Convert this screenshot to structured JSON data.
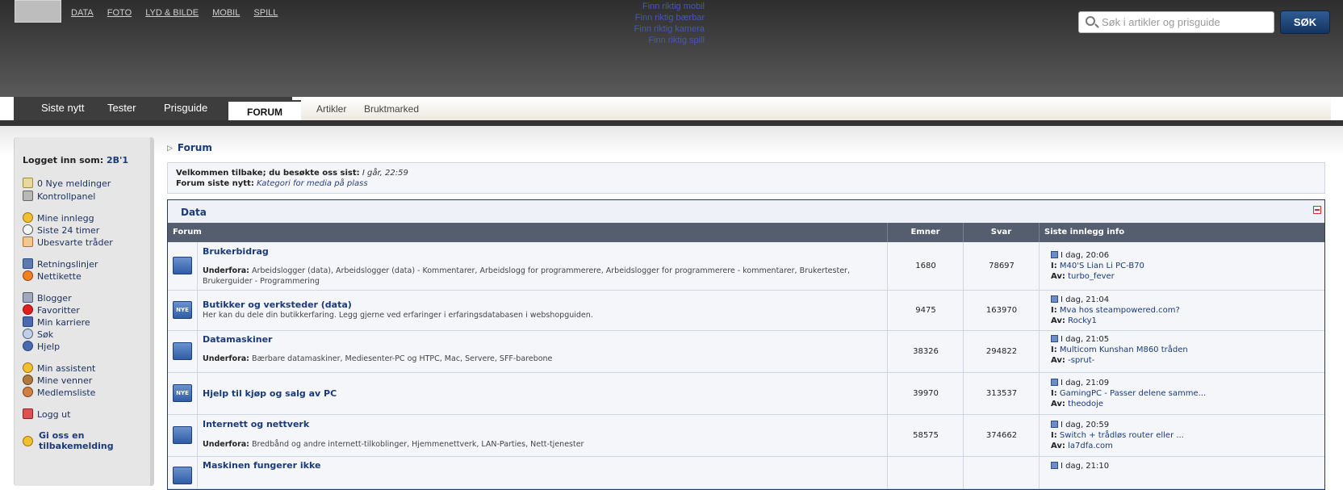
{
  "header": {
    "top_nav": [
      "DATA",
      "FOTO",
      "LYD & BILDE",
      "MOBIL",
      "SPILL"
    ],
    "promo_links": [
      "Finn riktig mobil",
      "Finn riktig bærbar",
      "Finn riktig kamera",
      "Finn riktig spill"
    ],
    "search_placeholder": "Søk i artikler og prisguide",
    "search_button": "SØK"
  },
  "tabs": {
    "main": [
      "Siste nytt",
      "Tester",
      "Prisguide",
      "FORUM"
    ],
    "sub": [
      "Artikler",
      "Bruktmarked"
    ]
  },
  "sidebar": {
    "login_label": "Logget inn som:",
    "username": "2B'1",
    "items": [
      {
        "label": "0 Nye meldinger",
        "icon": "mail-icon"
      },
      {
        "label": "Kontrollpanel",
        "icon": "tools-icon"
      },
      {
        "label": "Mine innlegg",
        "icon": "smiley-icon"
      },
      {
        "label": "Siste 24 timer",
        "icon": "clock-icon"
      },
      {
        "label": "Ubesvarte tråder",
        "icon": "envelope-icon"
      },
      {
        "label": "Retningslinjer",
        "icon": "rules-icon"
      },
      {
        "label": "Nettikette",
        "icon": "warning-icon"
      },
      {
        "label": "Blogger",
        "icon": "blog-icon"
      },
      {
        "label": "Favoritter",
        "icon": "heart-icon"
      },
      {
        "label": "Min karriere",
        "icon": "footprints-icon"
      },
      {
        "label": "Søk",
        "icon": "magnifier-icon"
      },
      {
        "label": "Hjelp",
        "icon": "help-icon"
      },
      {
        "label": "Min assistent",
        "icon": "assistant-icon"
      },
      {
        "label": "Mine venner",
        "icon": "friends-icon"
      },
      {
        "label": "Medlemsliste",
        "icon": "members-icon"
      },
      {
        "label": "Logg ut",
        "icon": "logout-icon"
      },
      {
        "label": "Gi oss en tilbakemelding",
        "icon": "feedback-smiley-icon"
      }
    ]
  },
  "main": {
    "breadcrumb": "Forum",
    "welcome_label": "Velkommen tilbake; du besøkte oss sist:",
    "welcome_time": "I går, 22:59",
    "news_label": "Forum siste nytt:",
    "news_text": "Kategori for media på plass",
    "category": "Data",
    "columns": [
      "Forum",
      "Emner",
      "Svar",
      "Siste innlegg info"
    ],
    "forums": [
      {
        "icon": "forum-icon",
        "title": "Brukerbidrag",
        "sub_label": "Underfora:",
        "sub": "Arbeidslogger (data), Arbeidslogger (data) - Kommentarer, Arbeidslogg for programmerere, Arbeidslogger for programmerere - kommentarer, Brukertester, Brukerguider - Programmering",
        "desc": "",
        "topics": "1680",
        "replies": "78697",
        "last_time": "I dag, 20:06",
        "last_in": "M40'S Lian Li PC-B70",
        "last_by": "turbo_fever"
      },
      {
        "icon": "new-forum-icon",
        "badge": "NYE",
        "title": "Butikker og verksteder (data)",
        "sub_label": "",
        "sub": "",
        "desc": "Her kan du dele din butikkerfaring. Legg gjerne ved erfaringer i erfaringsdatabasen i webshopguiden.",
        "topics": "9475",
        "replies": "163970",
        "last_time": "I dag, 21:04",
        "last_in": "Mva hos steampowered.com?",
        "last_by": "Rocky1"
      },
      {
        "icon": "forum-icon",
        "title": "Datamaskiner",
        "sub_label": "Underfora:",
        "sub": "Bærbare datamaskiner, Mediesenter-PC og HTPC, Mac, Servere, SFF-barebone",
        "desc": "",
        "topics": "38326",
        "replies": "294822",
        "last_time": "I dag, 21:05",
        "last_in": "Multicom Kunshan M860 tråden",
        "last_by": "-sprut-"
      },
      {
        "icon": "new-forum-icon",
        "badge": "NYE",
        "title": "Hjelp til kjøp og salg av PC",
        "sub_label": "",
        "sub": "",
        "desc": "",
        "topics": "39970",
        "replies": "313537",
        "last_time": "I dag, 21:09",
        "last_in": "GamingPC - Passer delene samme...",
        "last_by": "theodoje"
      },
      {
        "icon": "forum-icon",
        "title": "Internett og nettverk",
        "sub_label": "Underfora:",
        "sub": "Bredbånd og andre internett-tilkoblinger, Hjemmenettverk, LAN-Parties, Nett-tjenester",
        "desc": "",
        "topics": "58575",
        "replies": "374662",
        "last_time": "I dag, 20:59",
        "last_in": "Switch + trådløs router eller ...",
        "last_by": "la7dfa.com"
      },
      {
        "icon": "forum-icon",
        "title": "Maskinen fungerer ikke",
        "sub_label": "",
        "sub": "",
        "desc": "",
        "topics": "",
        "replies": "",
        "last_time": "I dag, 21:10",
        "last_in": "",
        "last_by": ""
      }
    ],
    "last_in_label": "I:",
    "last_by_label": "Av:"
  }
}
